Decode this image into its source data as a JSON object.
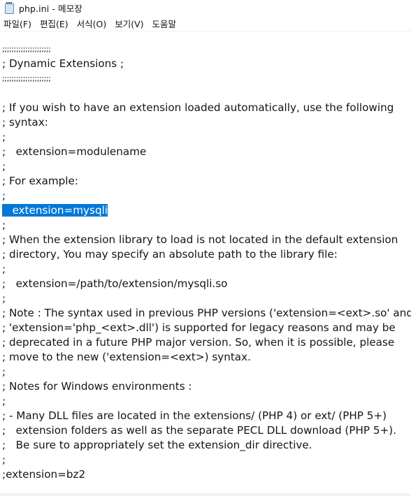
{
  "window": {
    "title": "php.ini - 메모장",
    "icon": "notepad-icon"
  },
  "menu": [
    {
      "label": "파일(F)"
    },
    {
      "label": "편집(E)"
    },
    {
      "label": "서식(O)"
    },
    {
      "label": "보기(V)"
    },
    {
      "label": "도움말"
    }
  ],
  "editor": {
    "selection_color": "#0078d7",
    "lines": [
      ";;;;;;;;;;;;;;;;;;;;;",
      "; Dynamic Extensions ;",
      ";;;;;;;;;;;;;;;;;;;;;",
      "",
      "; If you wish to have an extension loaded automatically, use the following",
      "; syntax:",
      ";",
      ";   extension=modulename",
      ";",
      "; For example:",
      ";",
      "   extension=mysqli",
      ";",
      "; When the extension library to load is not located in the default extension",
      "; directory, You may specify an absolute path to the library file:",
      ";",
      ";   extension=/path/to/extension/mysqli.so",
      ";",
      "; Note : The syntax used in previous PHP versions ('extension=<ext>.so' and",
      "; 'extension='php_<ext>.dll') is supported for legacy reasons and may be",
      "; deprecated in a future PHP major version. So, when it is possible, please",
      "; move to the new ('extension=<ext>) syntax.",
      ";",
      "; Notes for Windows environments :",
      ";",
      "; - Many DLL files are located in the extensions/ (PHP 4) or ext/ (PHP 5+)",
      ";   extension folders as well as the separate PECL DLL download (PHP 5+).",
      ";   Be sure to appropriately set the extension_dir directive.",
      ";",
      ";extension=bz2"
    ]
  }
}
